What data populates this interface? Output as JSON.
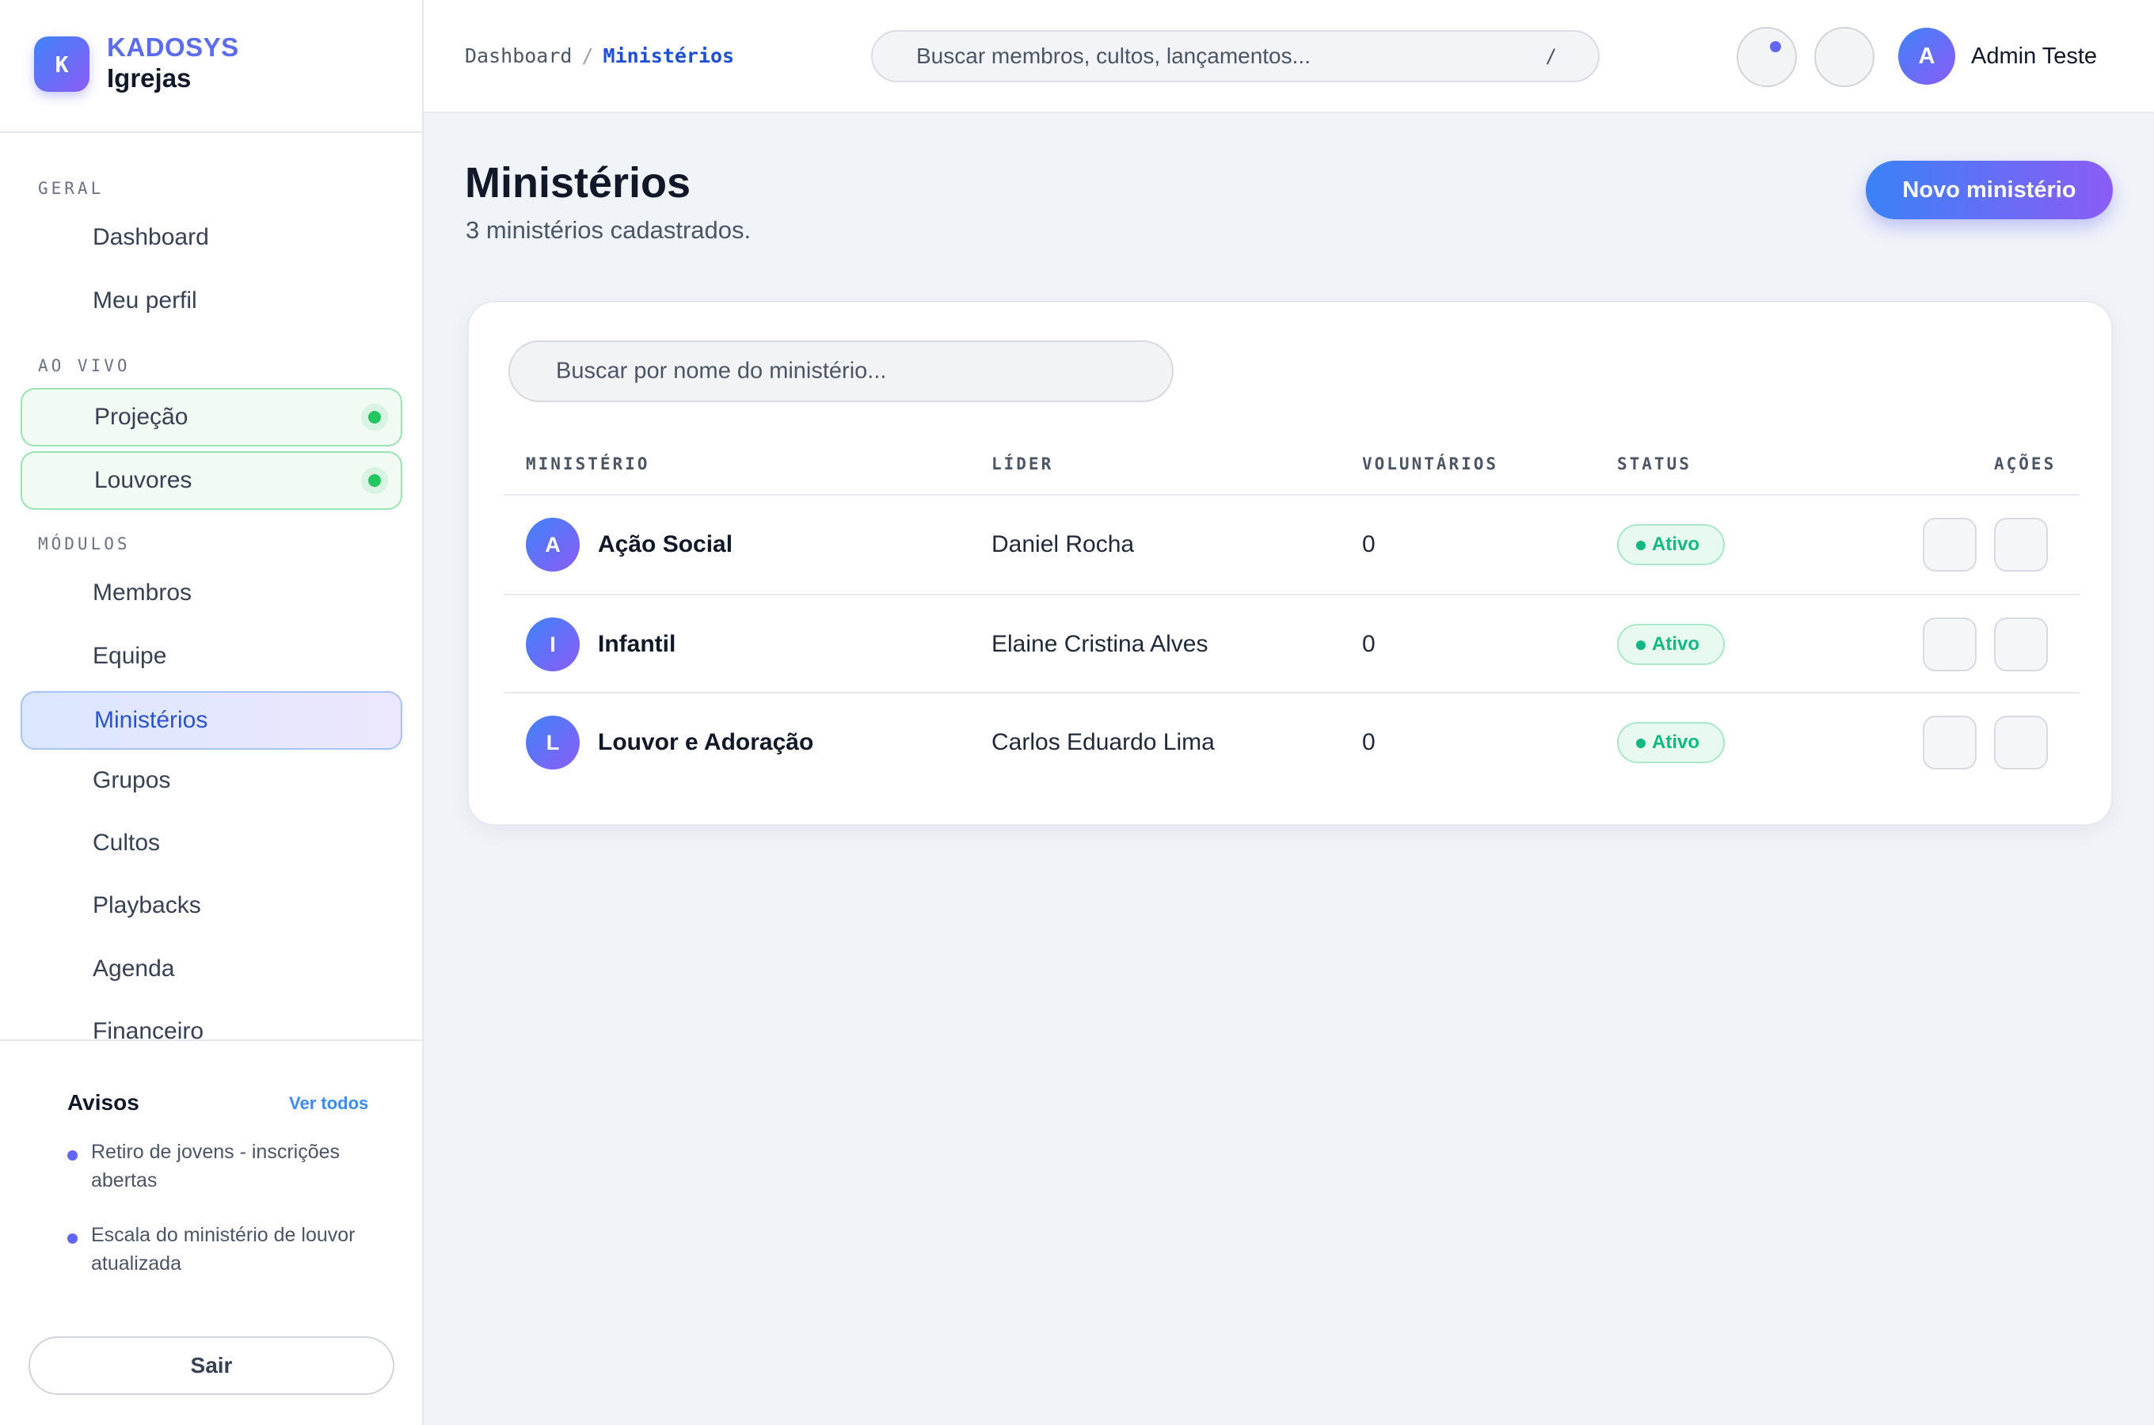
{
  "brand": {
    "logo_letter": "K",
    "name": "KADOSYS",
    "subtitle": "Igrejas"
  },
  "sidebar": {
    "sections": [
      {
        "label": "GERAL",
        "items": [
          {
            "label": "Dashboard"
          },
          {
            "label": "Meu perfil"
          }
        ]
      },
      {
        "label": "AO VIVO",
        "items": [
          {
            "label": "Projeção",
            "live": true
          },
          {
            "label": "Louvores",
            "live": true
          }
        ]
      },
      {
        "label": "MÓDULOS",
        "items": [
          {
            "label": "Membros"
          },
          {
            "label": "Equipe"
          },
          {
            "label": "Ministérios",
            "active": true
          },
          {
            "label": "Grupos"
          },
          {
            "label": "Cultos"
          },
          {
            "label": "Playbacks"
          },
          {
            "label": "Agenda"
          },
          {
            "label": "Financeiro"
          }
        ]
      }
    ]
  },
  "avisos": {
    "title": "Avisos",
    "link": "Ver todos",
    "items": [
      "Retiro de jovens - inscrições abertas",
      "Escala do ministério de louvor atualizada"
    ],
    "logout_label": "Sair"
  },
  "topbar": {
    "breadcrumb": {
      "root": "Dashboard",
      "separator": "/",
      "current": "Ministérios"
    },
    "search": {
      "placeholder": "Buscar membros, cultos, lançamentos...",
      "shortcut": "/"
    },
    "user": {
      "initial": "A",
      "name": "Admin Teste"
    }
  },
  "page": {
    "title": "Ministérios",
    "subtitle": "3 ministérios cadastrados.",
    "new_button": "Novo ministério"
  },
  "table": {
    "search_placeholder": "Buscar por nome do ministério...",
    "columns": [
      "MINISTÉRIO",
      "LÍDER",
      "VOLUNTÁRIOS",
      "STATUS",
      "AÇÕES"
    ],
    "rows": [
      {
        "initial": "A",
        "name": "Ação Social",
        "leader": "Daniel Rocha",
        "volunteers": "0",
        "status": "Ativo"
      },
      {
        "initial": "I",
        "name": "Infantil",
        "leader": "Elaine Cristina Alves",
        "volunteers": "0",
        "status": "Ativo"
      },
      {
        "initial": "L",
        "name": "Louvor e Adoração",
        "leader": "Carlos Eduardo Lima",
        "volunteers": "0",
        "status": "Ativo"
      }
    ]
  },
  "colors": {
    "accent": "#3b82f6",
    "accent_secondary": "#8b5cf6",
    "active_nav_text": "#2a53c9",
    "live_green": "#22c55e",
    "status_green": "#10b981",
    "background": "#f0f3f8"
  }
}
